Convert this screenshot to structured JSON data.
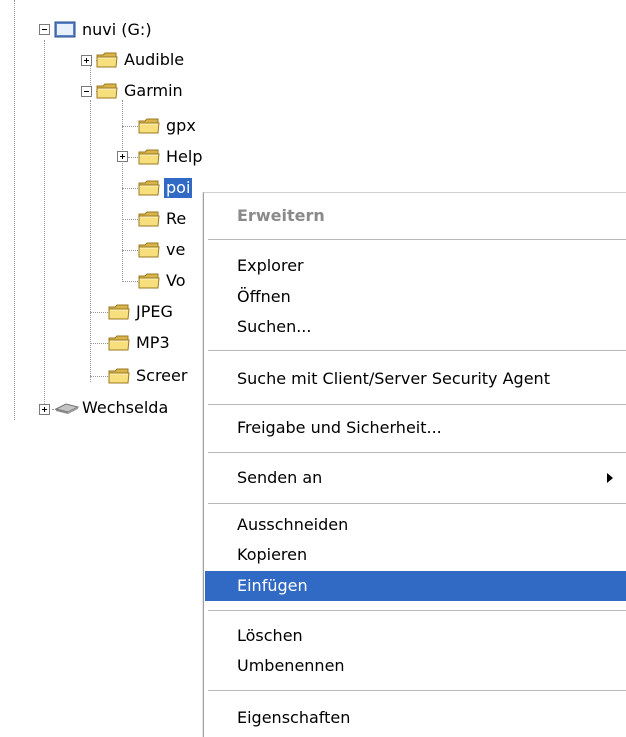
{
  "tree": {
    "items": [
      {
        "label": "nuvi (G:)",
        "expander": "minus",
        "icon": "drive-icon"
      },
      {
        "label": "Audible",
        "expander": "plus",
        "icon": "folder-icon"
      },
      {
        "label": "Garmin",
        "expander": "minus",
        "icon": "folder-icon"
      },
      {
        "label": "gpx",
        "expander": "none",
        "icon": "folder-icon"
      },
      {
        "label": "Help",
        "expander": "plus",
        "icon": "folder-icon"
      },
      {
        "label": "poi",
        "expander": "none",
        "icon": "folder-icon",
        "selected": true
      },
      {
        "label": "Re",
        "expander": "none",
        "icon": "folder-icon"
      },
      {
        "label": "ve",
        "expander": "none",
        "icon": "folder-icon"
      },
      {
        "label": "Vo",
        "expander": "none",
        "icon": "folder-icon"
      },
      {
        "label": "JPEG",
        "expander": "none",
        "icon": "folder-icon"
      },
      {
        "label": "MP3",
        "expander": "none",
        "icon": "folder-icon"
      },
      {
        "label": "Screer",
        "expander": "none",
        "icon": "folder-icon"
      },
      {
        "label": "Wechselda",
        "expander": "plus",
        "icon": "removable-drive-icon"
      }
    ]
  },
  "menu": {
    "expand": "Erweitern",
    "explorer": "Explorer",
    "open": "Öffnen",
    "search": "Suchen...",
    "security_search": "Suche mit Client/Server Security Agent",
    "share": "Freigabe und Sicherheit...",
    "send_to": "Senden an",
    "cut": "Ausschneiden",
    "copy": "Kopieren",
    "paste": "Einfügen",
    "delete": "Löschen",
    "rename": "Umbenennen",
    "properties": "Eigenschaften"
  },
  "colors": {
    "selection": "#316ac5",
    "folder": "#f5d86a"
  }
}
